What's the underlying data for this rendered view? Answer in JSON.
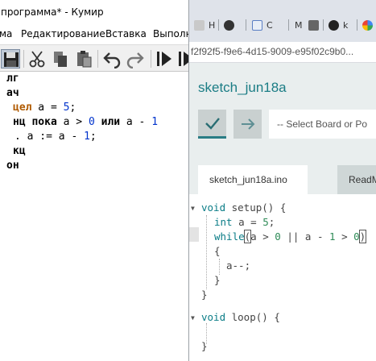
{
  "kumir": {
    "title": "программа* - Кумир",
    "menu": [
      "ма",
      "Редактирование",
      "Вставка",
      "Выполн"
    ],
    "toolbar_icons": [
      "save-icon",
      "cut-icon",
      "copy-icon",
      "paste-icon",
      "undo-icon",
      "redo-icon",
      "run-icon",
      "step-icon"
    ],
    "code": {
      "line1": "лг",
      "line2": "ач",
      "line3_kw": "цел",
      "line3_var": " a = ",
      "line3_num": "5",
      "line3_end": ";",
      "line4_kw": "нц пока",
      "line4_a": " a > ",
      "line4_num0": "0",
      "line4_kw2": " или",
      "line4_rest": " a - ",
      "line4_num1": "1",
      "line5_a": ". a := a - ",
      "line5_num": "1",
      "line5_end": ";",
      "line6": "кц",
      "line7": "он"
    }
  },
  "browser": {
    "tabs": [
      {
        "label": "Н",
        "icon": "page-icon"
      },
      {
        "label": "",
        "icon": "bug-icon"
      },
      {
        "label": "С",
        "icon": "doc-icon"
      },
      {
        "label": "М",
        "icon": "page-icon"
      },
      {
        "label": "",
        "icon": "speaker-icon"
      },
      {
        "label": "k",
        "icon": "github-icon"
      },
      {
        "label": "",
        "icon": "google-icon"
      }
    ],
    "url": "f2f92f5-f9e6-4d15-9009-e95f02c9b0..."
  },
  "arduino": {
    "sketch_title": "sketch_jun18a",
    "board_placeholder": "-- Select Board or Po",
    "file_tab_active": "sketch_jun18a.ino",
    "file_tab_other": "ReadM",
    "accent": "#1b7d85",
    "code": {
      "l1_kw": "void",
      "l1_rest": " setup() {",
      "l2_kw": "int",
      "l2_rest": " a = ",
      "l2_num": "5",
      "l2_end": ";",
      "l3_kw": "while",
      "l3_open": "(",
      "l3_mid": "a > ",
      "l3_n0": "0",
      "l3_mid2": " || a - ",
      "l3_n1": "1",
      "l3_mid3": " > ",
      "l3_n2": "0",
      "l3_close": ")",
      "l4": "{",
      "l5": "a--;",
      "l6": "}",
      "l7": "}",
      "l9_kw": "void",
      "l9_rest": " loop() {",
      "l11": "}"
    }
  }
}
